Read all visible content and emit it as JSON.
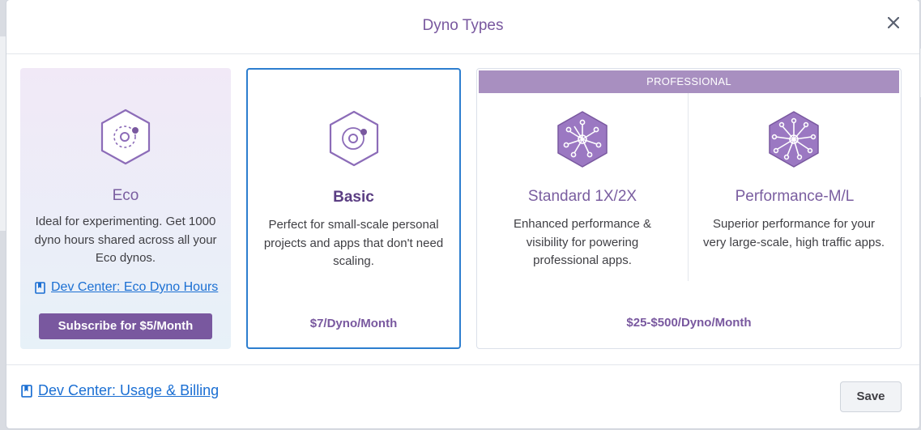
{
  "modal": {
    "title": "Dyno Types"
  },
  "eco": {
    "title": "Eco",
    "description": "Ideal for experimenting. Get 1000 dyno hours shared across all your Eco dynos.",
    "link": "Dev Center: Eco Dyno Hours",
    "subscribe": "Subscribe for $5/Month"
  },
  "basic": {
    "title": "Basic",
    "description": "Perfect for small-scale personal projects and apps that don't need scaling.",
    "price": "$7/Dyno/Month"
  },
  "professional": {
    "banner": "PROFESSIONAL",
    "standard": {
      "title": "Standard 1X/2X",
      "description": "Enhanced performance & visibility for powering professional apps."
    },
    "performance": {
      "title": "Performance-M/L",
      "description": "Superior performance for your very large-scale, high traffic apps."
    },
    "price": "$25-$500/Dyno/Month"
  },
  "footer": {
    "link": "Dev Center: Usage & Billing",
    "save": "Save"
  },
  "colors": {
    "brand_purple": "#79589f",
    "link_blue": "#1b6fd3",
    "selected_border": "#2d7ecf",
    "banner": "#a88fc0"
  }
}
